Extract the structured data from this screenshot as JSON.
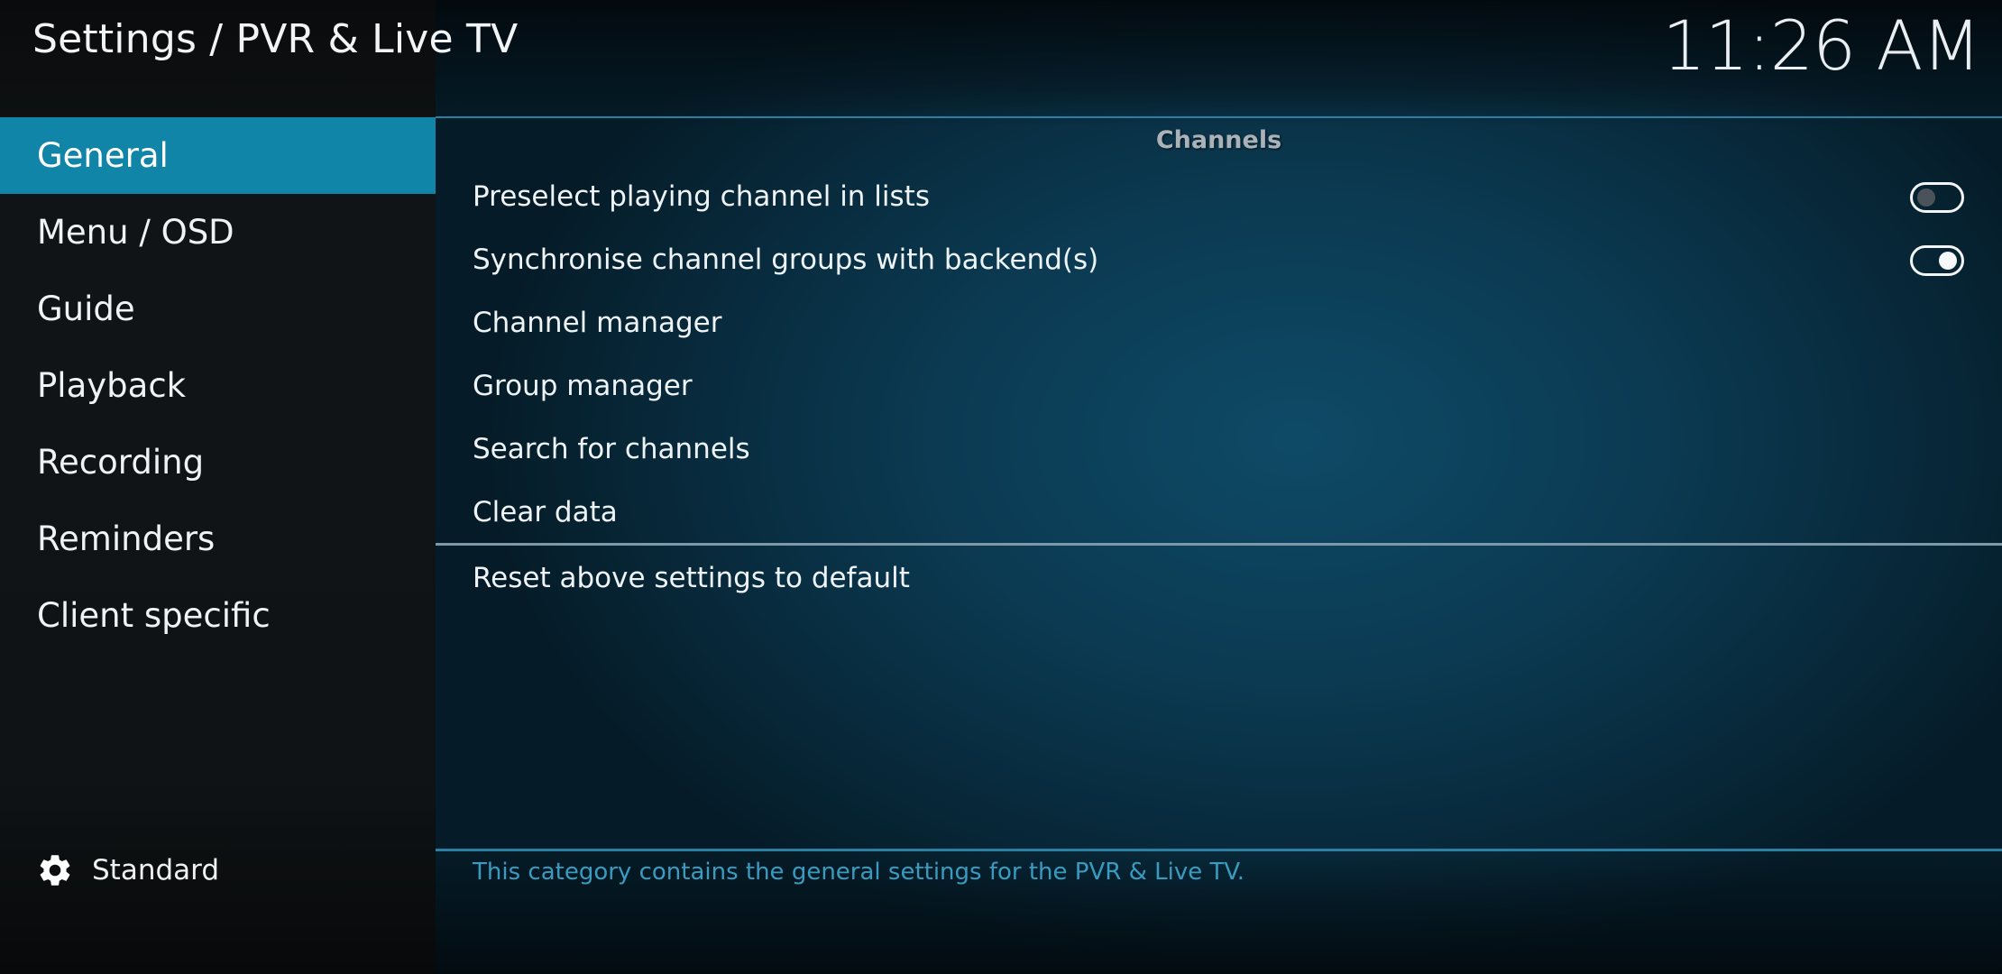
{
  "header": {
    "title": "Settings / PVR & Live TV",
    "clock": "11:26 AM"
  },
  "sidebar": {
    "items": [
      {
        "label": "General",
        "active": true
      },
      {
        "label": "Menu / OSD",
        "active": false
      },
      {
        "label": "Guide",
        "active": false
      },
      {
        "label": "Playback",
        "active": false
      },
      {
        "label": "Recording",
        "active": false
      },
      {
        "label": "Reminders",
        "active": false
      },
      {
        "label": "Client specific",
        "active": false
      }
    ],
    "level": {
      "icon": "gear-icon",
      "label": "Standard"
    }
  },
  "content": {
    "group_title": "Channels",
    "settings": [
      {
        "label": "Preselect playing channel in lists",
        "type": "toggle",
        "value": false
      },
      {
        "label": "Synchronise channel groups with backend(s)",
        "type": "toggle",
        "value": true
      },
      {
        "label": "Channel manager",
        "type": "action"
      },
      {
        "label": "Group manager",
        "type": "action"
      },
      {
        "label": "Search for channels",
        "type": "action"
      },
      {
        "label": "Clear data",
        "type": "action"
      }
    ],
    "reset_label": "Reset above settings to default",
    "description": "This category contains the general settings for the PVR & Live TV."
  },
  "colors": {
    "accent": "#1185a8",
    "description_text": "#3a9bc0",
    "rule": "#2a7fa2"
  }
}
